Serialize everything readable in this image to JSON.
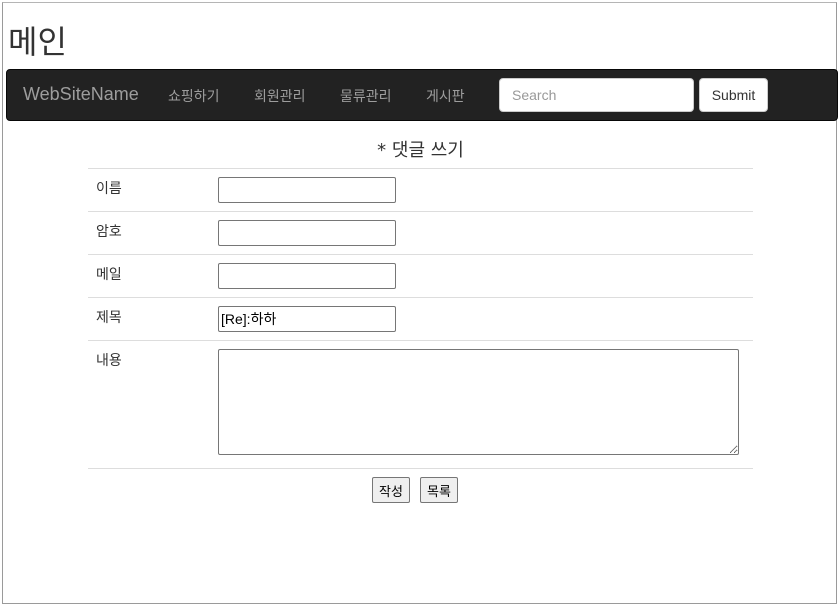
{
  "page": {
    "title": "메인"
  },
  "navbar": {
    "brand": "WebSiteName",
    "items": [
      {
        "label": "쇼핑하기"
      },
      {
        "label": "회원관리"
      },
      {
        "label": "물류관리"
      },
      {
        "label": "게시판"
      }
    ],
    "search": {
      "placeholder": "Search",
      "value": ""
    },
    "submit_label": "Submit"
  },
  "form": {
    "heading": "* 댓글 쓰기",
    "fields": {
      "name": {
        "label": "이름",
        "value": ""
      },
      "password": {
        "label": "암호",
        "value": ""
      },
      "email": {
        "label": "메일",
        "value": ""
      },
      "subject": {
        "label": "제목",
        "value": "[Re]:하하"
      },
      "content": {
        "label": "내용",
        "value": ""
      }
    },
    "write_label": "작성",
    "list_label": "목록"
  }
}
